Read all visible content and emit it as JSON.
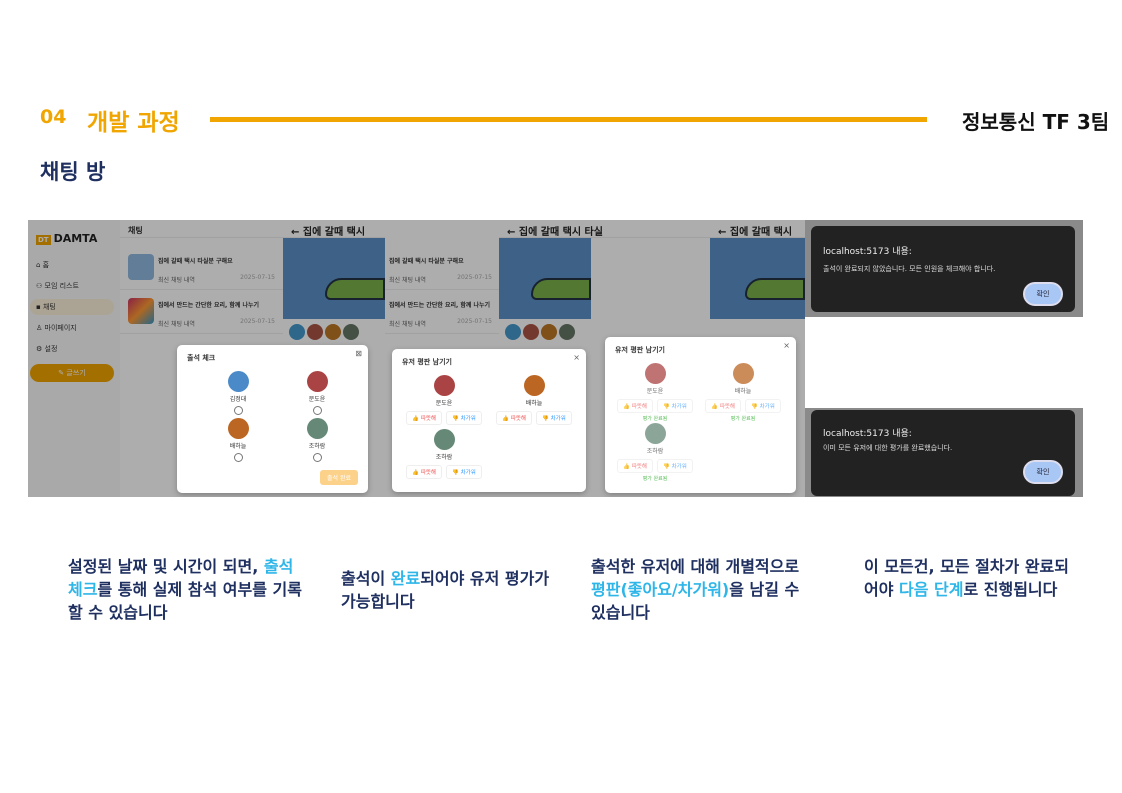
{
  "header": {
    "number": "04",
    "section": "개발 과정",
    "team": "정보통신 TF 3팀",
    "subtitle": "채팅 방"
  },
  "app": {
    "logo_badge": "DT",
    "logo": "DAMTA",
    "nav": [
      "홈",
      "모임 리스트",
      "채팅",
      "마이페이지",
      "설정"
    ],
    "write": "글쓰기",
    "list_title": "채팅",
    "rooms": [
      {
        "title": "집에 갈때 택시 타실분 구해요",
        "sub": "최신 채팅 내역",
        "date": "2025-07-15"
      },
      {
        "title": "집에서 만드는 간단한 요리, 함께 나누기",
        "sub": "최신 채팅 내역",
        "date": "2025-07-15"
      }
    ],
    "chat_title": "집에 갈때 택시 타실분",
    "chat_title2": "집에 갈때 택시 타실"
  },
  "attendance": {
    "title": "출석 체크",
    "users": [
      "김정대",
      "문도윤",
      "배하늘",
      "조하람"
    ],
    "submit": "출석 완료"
  },
  "rating": {
    "title": "유저 평판 남기기",
    "like": "따뜻해",
    "dislike": "차가워",
    "done": "평가 완료됨",
    "users": [
      "문도윤",
      "배하늘",
      "조하람"
    ]
  },
  "alerts": [
    {
      "host": "localhost:5173 내용:",
      "msg": "출석이 완료되지 않았습니다. 모든 인원을 체크해야 합니다.",
      "ok": "확인"
    },
    {
      "host": "localhost:5173 내용:",
      "msg": "이미 모든 유저에 대한 평가를 완료했습니다.",
      "ok": "확인"
    }
  ],
  "captions": [
    {
      "a": "설정된 날짜 및 시간이 되면, ",
      "b": "출석 체크",
      "c": "를 통해 실제 참석 여부를 기록할 수 있습니다"
    },
    {
      "a": "출석이 ",
      "b": "완료",
      "c": "되어야 유저 평가가 가능합니다"
    },
    {
      "a": "출석한 유저에 대해 개별적으로 ",
      "b": "평판(좋아요/차가워)",
      "c": "을 남길 수 있습니다"
    },
    {
      "a": "이 모든건, 모든 절차가 완료되어야 ",
      "b": "다음 단계",
      "c": "로 진행됩니다"
    }
  ]
}
